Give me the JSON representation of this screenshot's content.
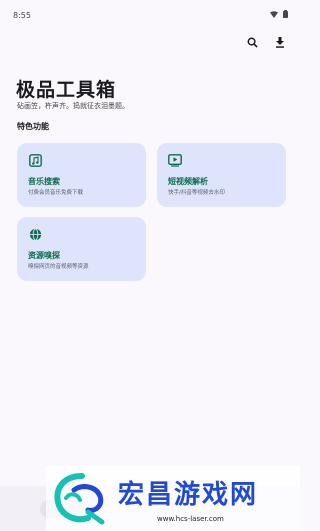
{
  "status": {
    "time": "8:55"
  },
  "toolbar": {
    "search_icon": "search-icon",
    "download_icon": "download-icon"
  },
  "header": {
    "title": "极品工具箱",
    "subtitle": "砧画笠，杵声齐。捣就征衣泪墨题。"
  },
  "section": {
    "title": "特色功能"
  },
  "cards": [
    {
      "title": "音乐搜索",
      "desc": "付费会员音乐免费下载",
      "icon": "music-note-icon"
    },
    {
      "title": "短视频解析",
      "desc": "快手/抖音等视频去水印",
      "icon": "video-play-icon"
    },
    {
      "title": "资源嗅探",
      "desc": "嗅探网页的音视频等资源",
      "icon": "globe-icon"
    }
  ],
  "watermark": {
    "name": "宏昌游戏网",
    "url": "www.hcs-laser.com"
  },
  "colors": {
    "card_bg": "#dde4fb",
    "accent": "#0e6b4f",
    "background": "#fbf8fd"
  }
}
